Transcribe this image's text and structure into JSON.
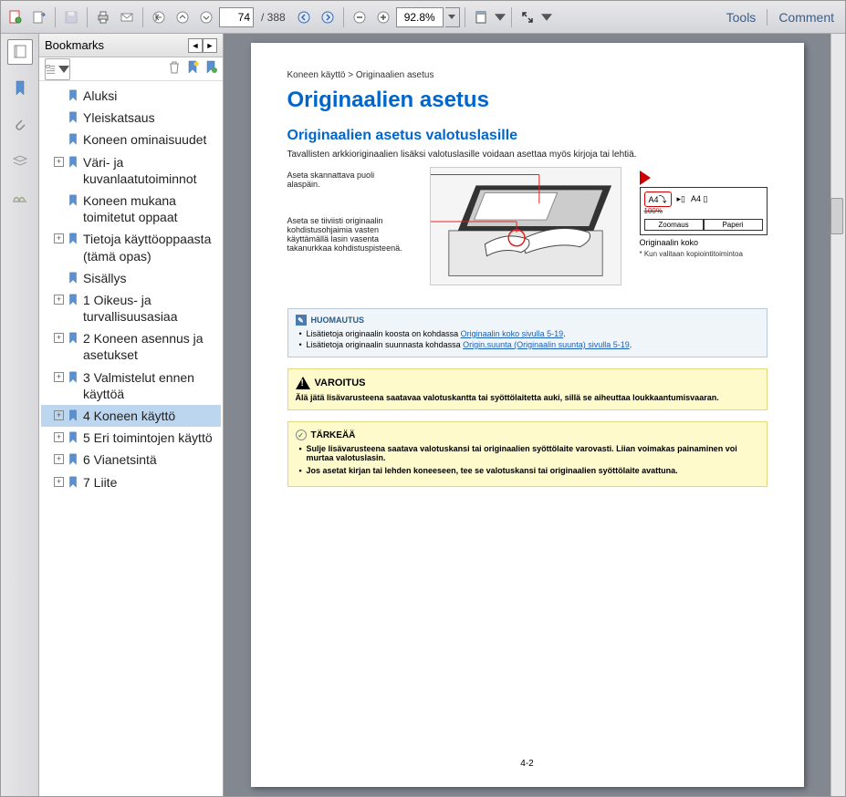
{
  "toolbar": {
    "page_current": "74",
    "page_total": "/ 388",
    "zoom": "92.8%",
    "tools": "Tools",
    "comment": "Comment"
  },
  "bookmarks": {
    "title": "Bookmarks",
    "items": [
      {
        "label": "Aluksi",
        "expandable": false,
        "level": 1
      },
      {
        "label": "Yleiskatsaus",
        "expandable": false,
        "level": 1
      },
      {
        "label": "Koneen ominaisuudet",
        "expandable": false,
        "level": 1
      },
      {
        "label": "Väri- ja kuvanlaatutoiminnot",
        "expandable": true,
        "level": 1
      },
      {
        "label": "Koneen mukana toimitetut oppaat",
        "expandable": false,
        "level": 1
      },
      {
        "label": "Tietoja käyttöoppaasta (tämä opas)",
        "expandable": true,
        "level": 1
      },
      {
        "label": "Sisällys",
        "expandable": false,
        "level": 1
      },
      {
        "label": "1 Oikeus- ja turvallisuusasiaa",
        "expandable": true,
        "level": 1
      },
      {
        "label": "2 Koneen asennus ja asetukset",
        "expandable": true,
        "level": 1
      },
      {
        "label": "3 Valmistelut ennen käyttöä",
        "expandable": true,
        "level": 1
      },
      {
        "label": "4 Koneen käyttö",
        "expandable": true,
        "level": 1,
        "selected": true
      },
      {
        "label": "5 Eri toimintojen käyttö",
        "expandable": true,
        "level": 1
      },
      {
        "label": "6 Vianetsintä",
        "expandable": true,
        "level": 1
      },
      {
        "label": "7 Liite",
        "expandable": true,
        "level": 1
      }
    ]
  },
  "doc": {
    "breadcrumb": "Koneen käyttö > Originaalien asetus",
    "h1": "Originaalien asetus",
    "h2": "Originaalien asetus valotuslasille",
    "intro": "Tavallisten arkkioriginaalien lisäksi valotuslasille voidaan asettaa myös kirjoja tai lehtiä.",
    "callout1": "Aseta skannattava puoli alaspäin.",
    "callout2": "Aseta se tiiviisti originaalin kohdistusohjaimia vasten käyttämällä lasin vasenta takanurkkaa kohdistuspisteenä.",
    "panel": {
      "a4_1": "A4⤵",
      "a4_2": "A4 ▯",
      "strike": "100%",
      "tab1": "Zoomaus",
      "tab2": "Paperi",
      "caption": "Originaalin koko",
      "sub": "Kun valitaan kopiointitoimintoa"
    },
    "note": {
      "head": "HUOMAUTUS",
      "li1_pre": "Lisätietoja originaalin koosta on kohdassa ",
      "li1_link": "Originaalin koko sivulla 5-19",
      "li2_pre": "Lisätietoja originaalin suunnasta kohdassa ",
      "li2_link": "Origin.suunta (Originaalin suunta) sivulla 5-19"
    },
    "warn": {
      "head": "VAROITUS",
      "text": "Älä jätä lisävarusteena saatavaa valotuskantta tai syöttölaitetta auki, sillä se aiheuttaa loukkaantumisvaaran."
    },
    "important": {
      "head": "TÄRKEÄÄ",
      "li1": "Sulje lisävarusteena saatava valotuskansi tai originaalien syöttölaite varovasti. Liian voimakas painaminen voi murtaa valotuslasin.",
      "li2": "Jos asetat kirjan tai lehden koneeseen, tee se valotuskansi tai originaalien syöttölaite avattuna."
    },
    "page_num": "4-2"
  }
}
